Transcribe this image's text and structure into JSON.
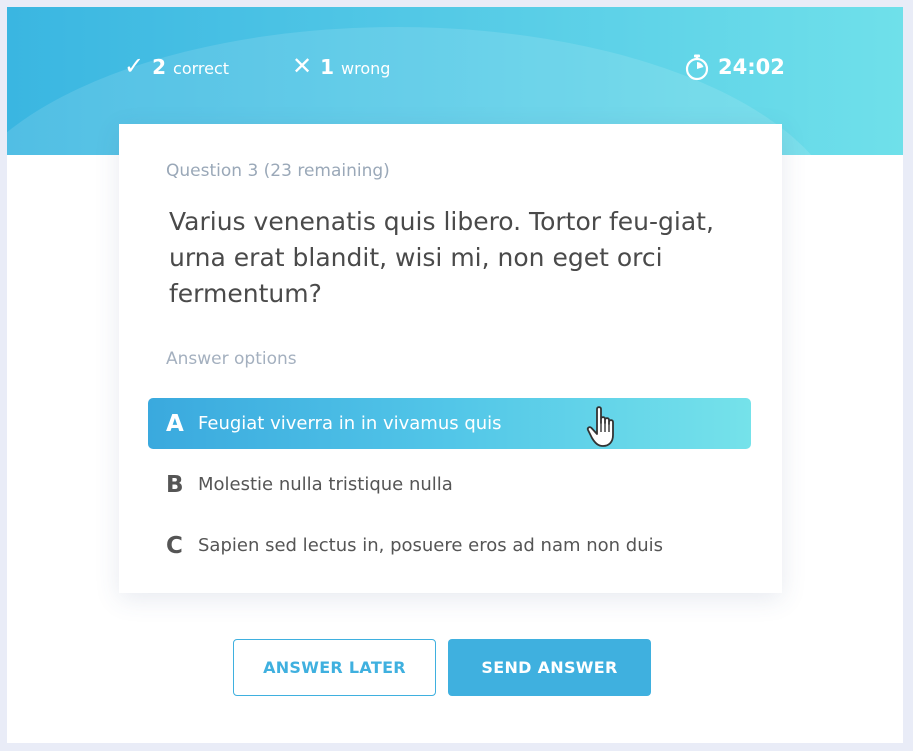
{
  "header": {
    "correct_count": "2",
    "correct_label": "correct",
    "wrong_count": "1",
    "wrong_label": "wrong",
    "timer": "24:02"
  },
  "question": {
    "number_text": "Question 3 (23 remaining)",
    "text": "Varius venenatis quis libero. Tortor feu-giat, urna erat blandit, wisi mi, non eget orci fermentum?",
    "options_label": "Answer options",
    "options": [
      {
        "letter": "A",
        "text": "Feugiat viverra in in vivamus quis",
        "selected": true
      },
      {
        "letter": "B",
        "text": "Molestie nulla tristique nulla",
        "selected": false
      },
      {
        "letter": "C",
        "text": "Sapien sed lectus in, posuere eros ad nam non duis",
        "selected": false
      }
    ]
  },
  "actions": {
    "later_label": "ANSWER LATER",
    "send_label": "SEND ANSWER"
  },
  "colors": {
    "accent": "#3fb0df",
    "gradient_start": "#3aa9de",
    "gradient_end": "#75e2ea",
    "text": "#4a4a4a",
    "muted": "#9aa8b8"
  },
  "icons": [
    "check-icon",
    "cross-icon",
    "stopwatch-icon",
    "hand-cursor-icon"
  ]
}
